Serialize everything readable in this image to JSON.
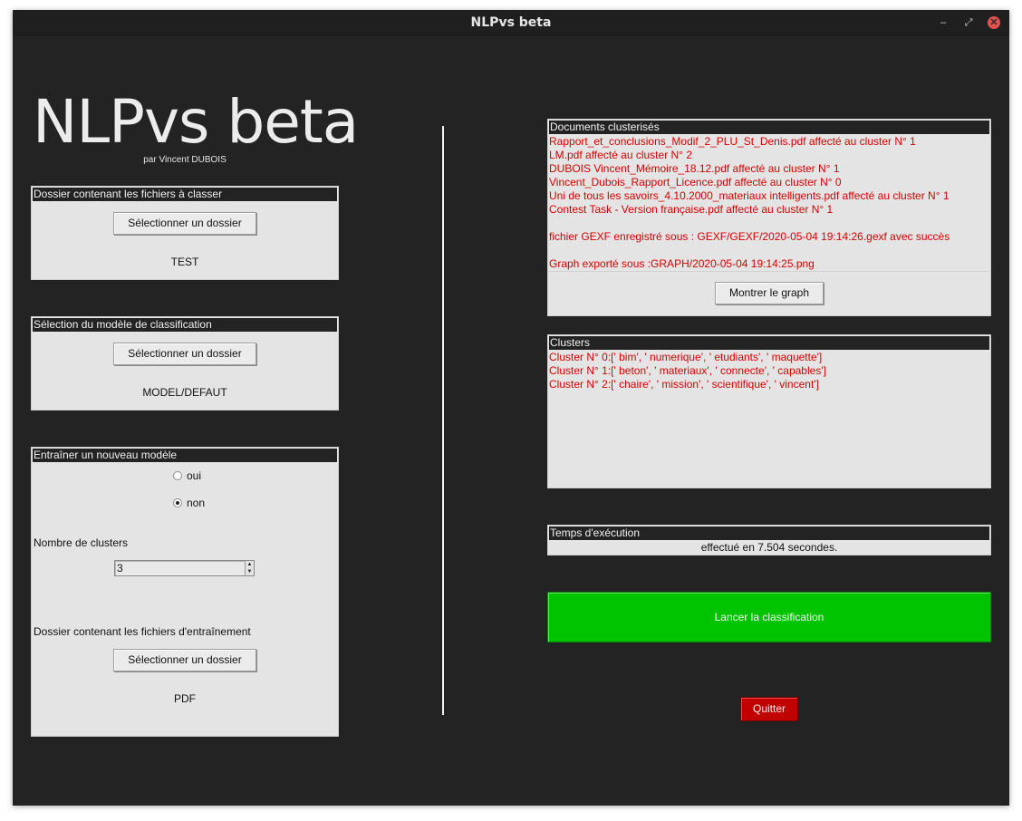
{
  "window": {
    "title": "NLPvs beta",
    "controls": {
      "minimize": "–",
      "maximize": "⤢",
      "close": "✕"
    }
  },
  "app": {
    "title": "NLPvs beta",
    "subtitle": "par Vincent DUBOIS"
  },
  "panel_files": {
    "header": "Dossier contenant les fichiers à classer",
    "button": "Sélectionner un dossier",
    "value": "TEST"
  },
  "panel_model": {
    "header": "Sélection du modèle de classification",
    "button": "Sélectionner un dossier",
    "value": "MODEL/DEFAUT"
  },
  "panel_train": {
    "header": "Entraîner un nouveau modèle",
    "options": [
      {
        "label": "oui",
        "selected": false
      },
      {
        "label": "non",
        "selected": true
      }
    ],
    "clusters_label": "Nombre de clusters",
    "clusters_value": "3",
    "training_folder_label": "Dossier contenant les fichiers d'entraînement",
    "button": "Sélectionner un dossier",
    "value": "PDF"
  },
  "documents": {
    "header": "Documents clusterisés",
    "lines": [
      "Rapport_et_conclusions_Modif_2_PLU_St_Denis.pdf affecté au cluster N° 1",
      "LM.pdf affecté au cluster N° 2",
      "DUBOIS Vincent_Mémoire_18.12.pdf affecté au cluster N° 1",
      "Vincent_Dubois_Rapport_Licence.pdf affecté au cluster N° 0",
      "Uni de tous les savoirs_4.10.2000_materiaux intelligents.pdf affecté au cluster N° 1",
      "Contest Task - Version française.pdf affecté au cluster N° 1",
      "",
      "fichier GEXF enregistré sous : GEXF/GEXF/2020-05-04 19:14:26.gexf avec succès",
      "",
      "Graph exporté sous :GRAPH/2020-05-04 19:14:25.png"
    ],
    "button": "Montrer le graph"
  },
  "clusters": {
    "header": "Clusters",
    "lines": [
      "Cluster N° 0:[' bim', ' numerique', ' etudiants', ' maquette']",
      "Cluster N° 1:[' beton', ' materiaux', ' connecte', ' capables']",
      "Cluster N° 2:[' chaire', ' mission', ' scientifique', ' vincent']"
    ]
  },
  "timing": {
    "header": "Temps d'exécution",
    "value": "effectué en 7.504 secondes."
  },
  "actions": {
    "launch": "Lancer la classification",
    "quit": "Quitter"
  },
  "colors": {
    "background": "#232323",
    "panel": "#e4e4e4",
    "output_text": "#d80000",
    "launch": "#00c400",
    "quit": "#c10000",
    "close_button": "#e0524f"
  }
}
